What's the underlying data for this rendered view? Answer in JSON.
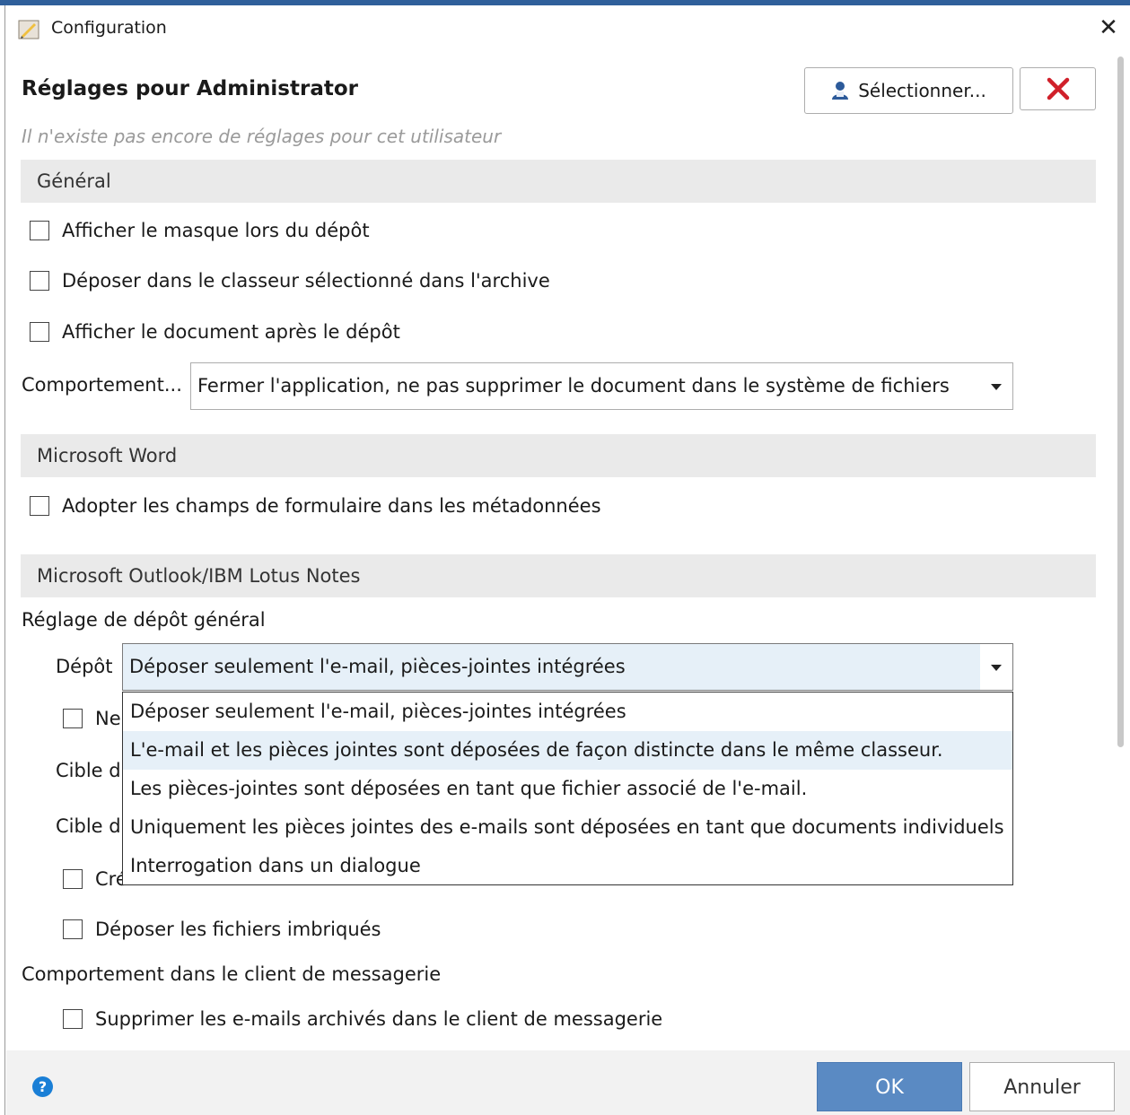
{
  "window": {
    "title": "Configuration"
  },
  "header": {
    "title": "Réglages pour  Administrator",
    "select_label": "Sélectionner...",
    "subtitle": "Il n'existe pas encore de réglages pour cet utilisateur"
  },
  "general": {
    "heading": "Général",
    "checkbox_1": "Afficher le masque lors du dépôt",
    "checkbox_2": "Déposer dans le classeur sélectionné dans l'archive",
    "checkbox_3": "Afficher le document après le dépôt",
    "behavior_label": "Comportement...",
    "behavior_value": "Fermer l'application, ne pas supprimer le document dans le système de fichiers"
  },
  "word": {
    "heading": "Microsoft Word",
    "checkbox_1": "Adopter les champs de formulaire dans les métadonnées"
  },
  "outlook": {
    "heading": "Microsoft Outlook/IBM Lotus Notes",
    "general_setting_label": "Réglage de dépôt général",
    "depot_label": "Dépôt",
    "depot_value": "Déposer seulement l'e-mail, pièces-jointes intégrées",
    "partial_checkbox": "Ne",
    "target_label_1": "Cible d",
    "target_label_2": "Cible d",
    "partial_checkbox_2": "Cré",
    "nested_files": "Déposer les fichiers imbriqués",
    "mail_client_label": "Comportement dans le client de messagerie",
    "delete_archived": "Supprimer les e-mails archivés dans le client de messagerie"
  },
  "dropdown": {
    "options": [
      "Déposer seulement l'e-mail, pièces-jointes intégrées",
      "L'e-mail et les pièces jointes sont déposées de façon distincte dans le même classeur.",
      "Les pièces-jointes sont déposées en tant que fichier associé de l'e-mail.",
      "Uniquement les pièces jointes des e-mails sont déposées en tant que documents individuels",
      "Interrogation dans un dialogue"
    ]
  },
  "footer": {
    "help_glyph": "?",
    "ok_label": "OK",
    "cancel_label": "Annuler"
  },
  "icons": {
    "close": "close-icon",
    "user": "user-icon",
    "delete": "delete-x-icon",
    "help": "help-icon",
    "app": "app-icon"
  },
  "colors": {
    "accent": "#5a8ac3",
    "delete_red": "#d0202a",
    "hover": "#e6f0f8",
    "section_bg": "#eaeaea"
  }
}
